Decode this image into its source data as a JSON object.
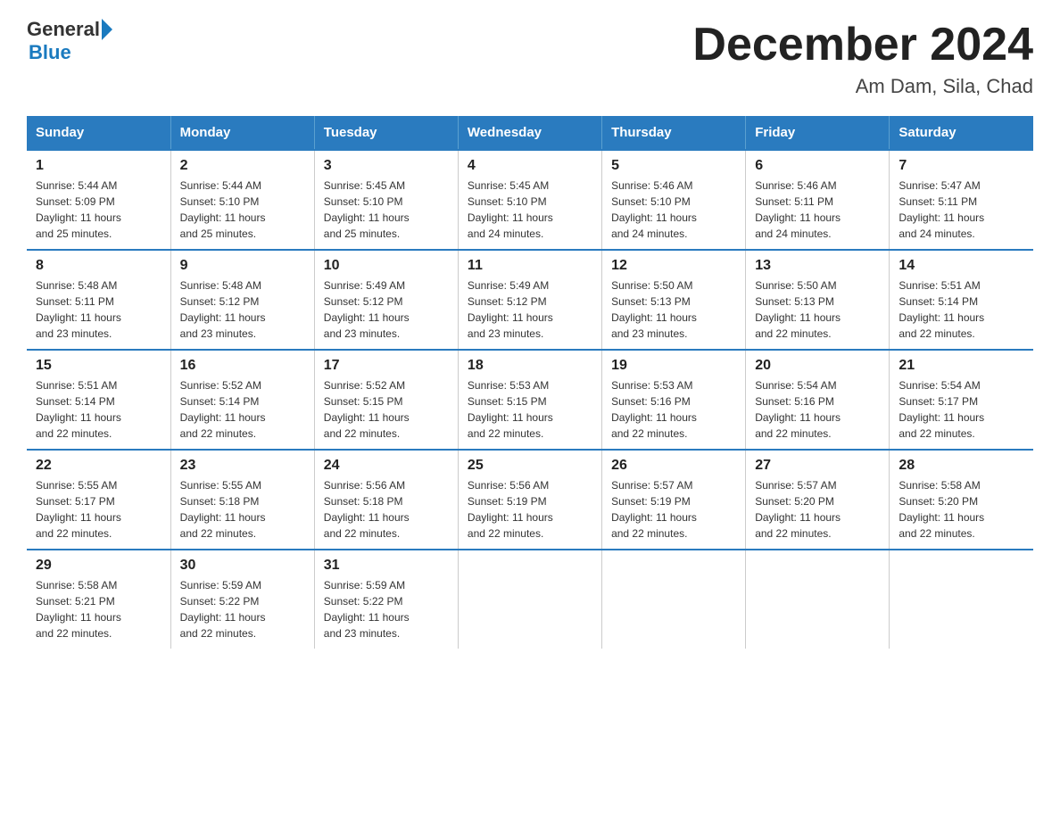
{
  "logo": {
    "text_general": "General",
    "text_blue": "Blue"
  },
  "title": "December 2024",
  "subtitle": "Am Dam, Sila, Chad",
  "days_of_week": [
    "Sunday",
    "Monday",
    "Tuesday",
    "Wednesday",
    "Thursday",
    "Friday",
    "Saturday"
  ],
  "weeks": [
    [
      {
        "day": "1",
        "sunrise": "5:44 AM",
        "sunset": "5:09 PM",
        "daylight": "11 hours and 25 minutes."
      },
      {
        "day": "2",
        "sunrise": "5:44 AM",
        "sunset": "5:10 PM",
        "daylight": "11 hours and 25 minutes."
      },
      {
        "day": "3",
        "sunrise": "5:45 AM",
        "sunset": "5:10 PM",
        "daylight": "11 hours and 25 minutes."
      },
      {
        "day": "4",
        "sunrise": "5:45 AM",
        "sunset": "5:10 PM",
        "daylight": "11 hours and 24 minutes."
      },
      {
        "day": "5",
        "sunrise": "5:46 AM",
        "sunset": "5:10 PM",
        "daylight": "11 hours and 24 minutes."
      },
      {
        "day": "6",
        "sunrise": "5:46 AM",
        "sunset": "5:11 PM",
        "daylight": "11 hours and 24 minutes."
      },
      {
        "day": "7",
        "sunrise": "5:47 AM",
        "sunset": "5:11 PM",
        "daylight": "11 hours and 24 minutes."
      }
    ],
    [
      {
        "day": "8",
        "sunrise": "5:48 AM",
        "sunset": "5:11 PM",
        "daylight": "11 hours and 23 minutes."
      },
      {
        "day": "9",
        "sunrise": "5:48 AM",
        "sunset": "5:12 PM",
        "daylight": "11 hours and 23 minutes."
      },
      {
        "day": "10",
        "sunrise": "5:49 AM",
        "sunset": "5:12 PM",
        "daylight": "11 hours and 23 minutes."
      },
      {
        "day": "11",
        "sunrise": "5:49 AM",
        "sunset": "5:12 PM",
        "daylight": "11 hours and 23 minutes."
      },
      {
        "day": "12",
        "sunrise": "5:50 AM",
        "sunset": "5:13 PM",
        "daylight": "11 hours and 23 minutes."
      },
      {
        "day": "13",
        "sunrise": "5:50 AM",
        "sunset": "5:13 PM",
        "daylight": "11 hours and 22 minutes."
      },
      {
        "day": "14",
        "sunrise": "5:51 AM",
        "sunset": "5:14 PM",
        "daylight": "11 hours and 22 minutes."
      }
    ],
    [
      {
        "day": "15",
        "sunrise": "5:51 AM",
        "sunset": "5:14 PM",
        "daylight": "11 hours and 22 minutes."
      },
      {
        "day": "16",
        "sunrise": "5:52 AM",
        "sunset": "5:14 PM",
        "daylight": "11 hours and 22 minutes."
      },
      {
        "day": "17",
        "sunrise": "5:52 AM",
        "sunset": "5:15 PM",
        "daylight": "11 hours and 22 minutes."
      },
      {
        "day": "18",
        "sunrise": "5:53 AM",
        "sunset": "5:15 PM",
        "daylight": "11 hours and 22 minutes."
      },
      {
        "day": "19",
        "sunrise": "5:53 AM",
        "sunset": "5:16 PM",
        "daylight": "11 hours and 22 minutes."
      },
      {
        "day": "20",
        "sunrise": "5:54 AM",
        "sunset": "5:16 PM",
        "daylight": "11 hours and 22 minutes."
      },
      {
        "day": "21",
        "sunrise": "5:54 AM",
        "sunset": "5:17 PM",
        "daylight": "11 hours and 22 minutes."
      }
    ],
    [
      {
        "day": "22",
        "sunrise": "5:55 AM",
        "sunset": "5:17 PM",
        "daylight": "11 hours and 22 minutes."
      },
      {
        "day": "23",
        "sunrise": "5:55 AM",
        "sunset": "5:18 PM",
        "daylight": "11 hours and 22 minutes."
      },
      {
        "day": "24",
        "sunrise": "5:56 AM",
        "sunset": "5:18 PM",
        "daylight": "11 hours and 22 minutes."
      },
      {
        "day": "25",
        "sunrise": "5:56 AM",
        "sunset": "5:19 PM",
        "daylight": "11 hours and 22 minutes."
      },
      {
        "day": "26",
        "sunrise": "5:57 AM",
        "sunset": "5:19 PM",
        "daylight": "11 hours and 22 minutes."
      },
      {
        "day": "27",
        "sunrise": "5:57 AM",
        "sunset": "5:20 PM",
        "daylight": "11 hours and 22 minutes."
      },
      {
        "day": "28",
        "sunrise": "5:58 AM",
        "sunset": "5:20 PM",
        "daylight": "11 hours and 22 minutes."
      }
    ],
    [
      {
        "day": "29",
        "sunrise": "5:58 AM",
        "sunset": "5:21 PM",
        "daylight": "11 hours and 22 minutes."
      },
      {
        "day": "30",
        "sunrise": "5:59 AM",
        "sunset": "5:22 PM",
        "daylight": "11 hours and 22 minutes."
      },
      {
        "day": "31",
        "sunrise": "5:59 AM",
        "sunset": "5:22 PM",
        "daylight": "11 hours and 23 minutes."
      },
      null,
      null,
      null,
      null
    ]
  ],
  "labels": {
    "sunrise": "Sunrise:",
    "sunset": "Sunset:",
    "daylight": "Daylight:"
  }
}
